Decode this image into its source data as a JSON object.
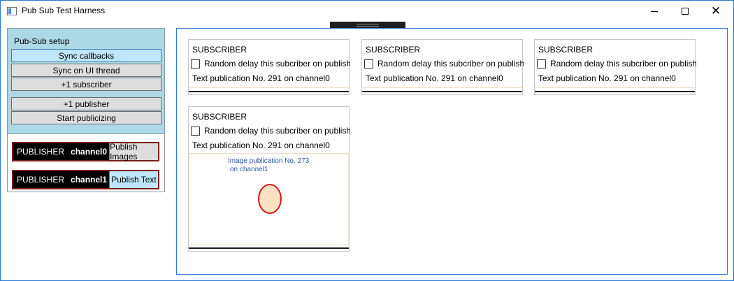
{
  "window": {
    "title": "Pub Sub Test Harness",
    "minimize_glyph": "",
    "maximize_glyph": "",
    "close_glyph": "✕"
  },
  "setup": {
    "label": "Pub-Sub setup",
    "buttons": [
      {
        "label": "Sync callbacks",
        "active": true
      },
      {
        "label": "Sync on UI thread",
        "active": false
      },
      {
        "label": "+1 subscriber",
        "active": false
      },
      {
        "label": "+1 publisher",
        "active": false
      },
      {
        "label": "Start publicizing",
        "active": false
      }
    ]
  },
  "publishers": [
    {
      "label": "PUBLISHER",
      "channel": "channel0",
      "button": "Publish Images"
    },
    {
      "label": "PUBLISHER",
      "channel": "channel1",
      "button": "Publish Text"
    }
  ],
  "subscribers": [
    {
      "title": "SUBSCRIBER",
      "checkbox_label": "Random delay this subcriber on publish",
      "checked": false,
      "text_publication": "Text publication No. 291 on channel0"
    },
    {
      "title": "SUBSCRIBER",
      "checkbox_label": "Random delay this subcriber on publish",
      "checked": false,
      "text_publication": "Text publication No. 291 on channel0"
    },
    {
      "title": "SUBSCRIBER",
      "checkbox_label": "Random delay this subcriber on publish",
      "checked": false,
      "text_publication": "Text publication No. 291 on channel0"
    },
    {
      "title": "SUBSCRIBER",
      "checkbox_label": "Random delay this subcriber on publish",
      "checked": false,
      "text_publication": "Text publication No. 291 on channel0",
      "image_caption_line1": "Image publication No. 273",
      "image_caption_line2": "on channel1"
    }
  ],
  "colors": {
    "setup_background": "#add8e6",
    "publisher_border": "#7b1e1e",
    "image_caption": "#2a5aa8",
    "ellipse_fill": "#fde2c3",
    "ellipse_stroke": "#d11a1a",
    "window_border": "#2b79d0"
  },
  "icons": {
    "app": "app-window-icon",
    "minimize": "minimize-icon",
    "maximize": "maximize-icon",
    "close": "close-icon"
  }
}
